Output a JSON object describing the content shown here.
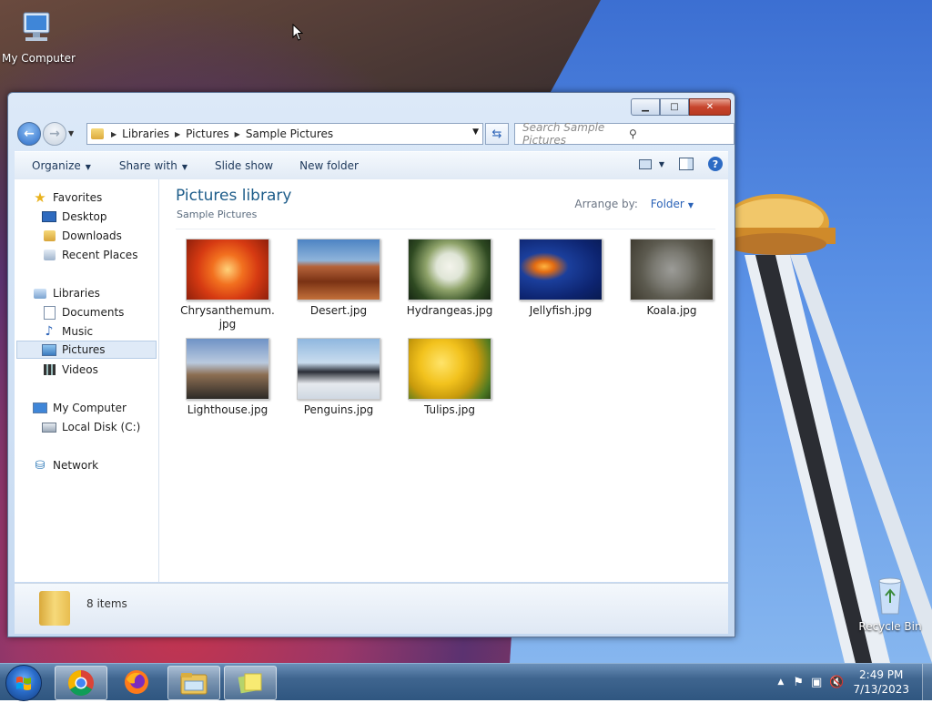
{
  "desktop": {
    "icons": [
      {
        "label": "My Computer"
      },
      {
        "label": "Recycle Bin"
      }
    ]
  },
  "window": {
    "address": [
      "Libraries",
      "Pictures",
      "Sample Pictures"
    ],
    "search_placeholder": "Search Sample Pictures",
    "commands": [
      "Organize",
      "Share with",
      "Slide show",
      "New folder"
    ],
    "help_label": "?",
    "nav": {
      "favorites": {
        "label": "Favorites",
        "items": [
          "Desktop",
          "Downloads",
          "Recent Places"
        ]
      },
      "libraries": {
        "label": "Libraries",
        "items": [
          "Documents",
          "Music",
          "Pictures",
          "Videos"
        ]
      },
      "computer": {
        "label": "My Computer",
        "items": [
          "Local Disk (C:)"
        ]
      },
      "network": {
        "label": "Network"
      }
    },
    "content": {
      "title": "Pictures library",
      "subtitle": "Sample Pictures",
      "arrange_label": "Arrange by:",
      "arrange_value": "Folder",
      "files": [
        {
          "name": "Chrysanthemum.",
          "name2": "jpg"
        },
        {
          "name": "Desert.jpg"
        },
        {
          "name": "Hydrangeas.jpg"
        },
        {
          "name": "Jellyfish.jpg"
        },
        {
          "name": "Koala.jpg"
        },
        {
          "name": "Lighthouse.jpg"
        },
        {
          "name": "Penguins.jpg"
        },
        {
          "name": "Tulips.jpg"
        }
      ]
    },
    "details": {
      "count": "8 items"
    }
  },
  "taskbar": {
    "time": "2:49 PM",
    "date": "7/13/2023"
  }
}
